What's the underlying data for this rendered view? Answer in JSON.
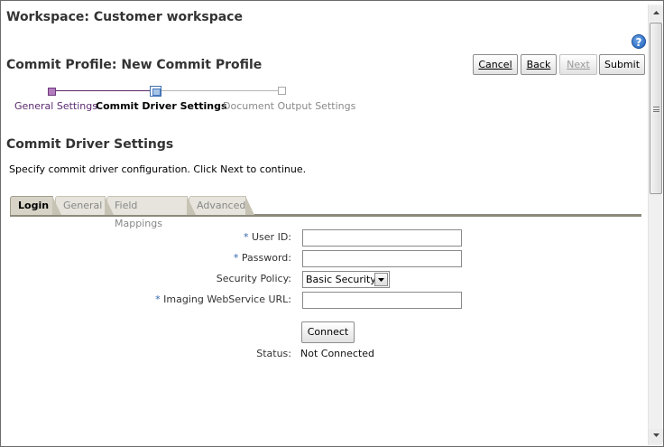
{
  "workspace_title": "Workspace: Customer workspace",
  "help": {
    "icon": "help-icon",
    "glyph": "?"
  },
  "profile_title": "Commit Profile: New Commit Profile",
  "toolbar": {
    "cancel_label": "Cancel",
    "back_label": "Back",
    "next_label": "Next",
    "submit_label": "Submit"
  },
  "train": {
    "steps": [
      {
        "label": "General Settings",
        "state": "visited"
      },
      {
        "label": "Commit Driver Settings",
        "state": "current"
      },
      {
        "label": "Document Output Settings",
        "state": "unvisited"
      }
    ]
  },
  "section_title": "Commit Driver Settings",
  "instructions": "Specify commit driver configuration. Click Next to continue.",
  "tabs": [
    {
      "label": "Login",
      "selected": true
    },
    {
      "label": "General",
      "selected": false
    },
    {
      "label": "Field Mappings",
      "selected": false
    },
    {
      "label": "Advanced",
      "selected": false
    }
  ],
  "form": {
    "required_marker": "*",
    "user_id_label": "User ID:",
    "user_id_value": "",
    "password_label": "Password:",
    "password_value": "",
    "security_policy_label": "Security Policy:",
    "security_policy_value": "Basic Security",
    "url_label": "Imaging WebService URL:",
    "url_value": "",
    "connect_label": "Connect",
    "status_label": "Status:",
    "status_value": "Not Connected"
  },
  "colors": {
    "visited_step": "#5b2a70",
    "required": "#3366aa",
    "tab_rule": "#8c8a7a"
  }
}
